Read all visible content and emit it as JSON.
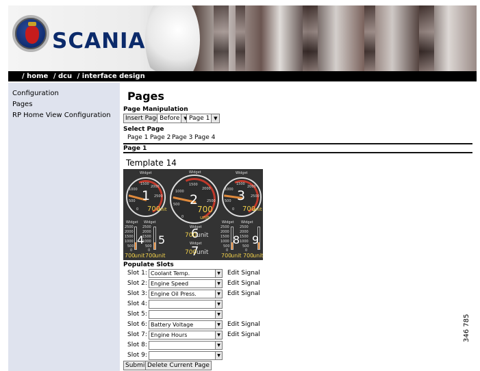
{
  "brand": "SCANIA",
  "breadcrumb": [
    "/ home",
    "/ dcu",
    "/ interface design"
  ],
  "sidebar": {
    "items": [
      {
        "label": "Configuration"
      },
      {
        "label": "Pages"
      },
      {
        "label": "RP Home View Configuration"
      }
    ]
  },
  "main": {
    "title": "Pages",
    "page_manipulation_label": "Page Manipulation",
    "insert_page_button": "Insert Page",
    "position_select": "Before",
    "page_select": "Page 1",
    "select_page_label": "Select Page",
    "page_links": [
      "Page 1",
      "Page 2",
      "Page 3",
      "Page 4"
    ],
    "current_page": "Page 1",
    "template": "Template 14"
  },
  "dashboard": {
    "gauge_title": "Widget",
    "gauges": [
      {
        "num": "1",
        "value": "700",
        "unit": "unit",
        "ticks": [
          "500",
          "1000",
          "1500",
          "2000",
          "2500"
        ],
        "min": "0"
      },
      {
        "num": "2",
        "value": "700",
        "unit": "unit",
        "ticks": [
          "500",
          "1000",
          "1500",
          "2000",
          "2500"
        ],
        "min": "0"
      },
      {
        "num": "3",
        "value": "700",
        "unit": "unit",
        "ticks": [
          "500",
          "1000",
          "1500",
          "2000",
          "2500"
        ],
        "min": "0"
      }
    ],
    "bars": [
      {
        "num": "4",
        "value": "700",
        "unit": "unit",
        "level": 0.3
      },
      {
        "num": "5",
        "value": "700",
        "unit": "unit",
        "level": 0.3
      },
      {
        "num": "8",
        "value": "700",
        "unit": "unit",
        "level": 0.3
      },
      {
        "num": "9",
        "value": "700",
        "unit": "unit",
        "level": 0.3
      }
    ],
    "bar_ticks": [
      "2500",
      "2000",
      "1500",
      "1000",
      "500",
      "0"
    ],
    "digitals": [
      {
        "num": "6",
        "value": "700",
        "unit": "unit"
      },
      {
        "num": "7",
        "value": "700",
        "unit": "unit"
      }
    ]
  },
  "slots": {
    "title": "Populate Slots",
    "edit_label": "Edit Signal",
    "rows": [
      {
        "label": "Slot 1:",
        "value": "Coolant Temp.",
        "edit": true
      },
      {
        "label": "Slot 2:",
        "value": "Engine Speed",
        "edit": true
      },
      {
        "label": "Slot 3:",
        "value": "Engine Oil Press.",
        "edit": true
      },
      {
        "label": "Slot 4:",
        "value": "",
        "edit": false
      },
      {
        "label": "Slot 5:",
        "value": "",
        "edit": false
      },
      {
        "label": "Slot 6:",
        "value": "Battery Voltage",
        "edit": true
      },
      {
        "label": "Slot 7:",
        "value": "Engine Hours",
        "edit": true
      },
      {
        "label": "Slot 8:",
        "value": "",
        "edit": false
      },
      {
        "label": "Slot 9:",
        "value": "",
        "edit": false
      }
    ]
  },
  "submit_button": "Submit",
  "delete_button": "Delete Current Page",
  "figure_id": "346 785"
}
